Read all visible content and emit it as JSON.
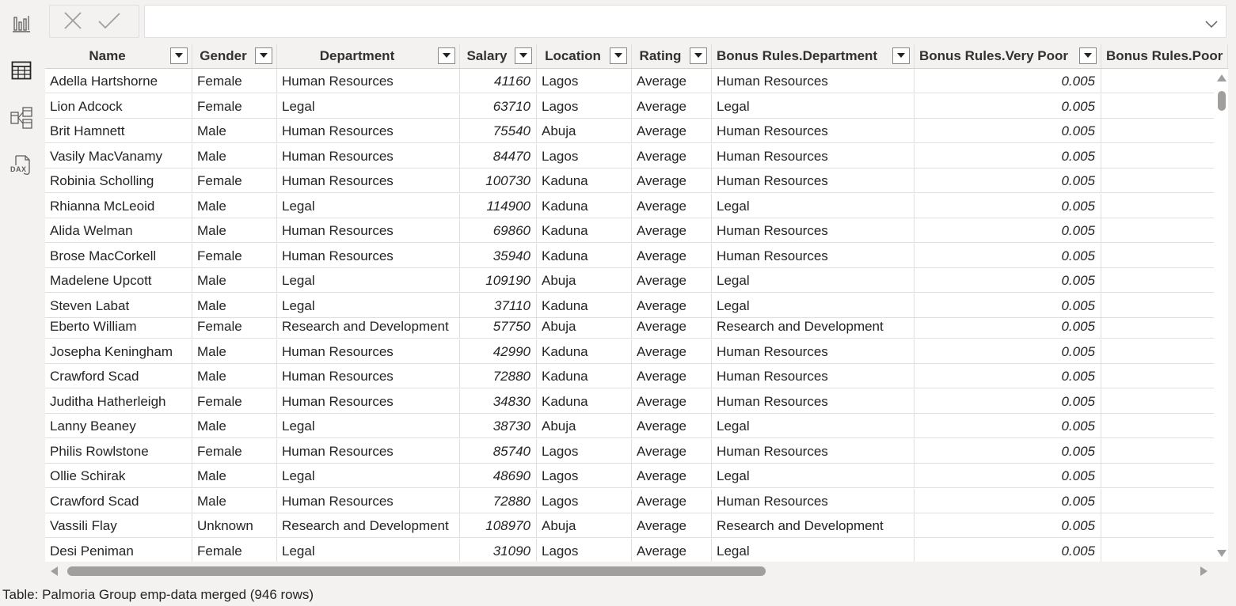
{
  "sidebar": {
    "items": [
      {
        "name": "report-view",
        "icon": "bar-chart-icon"
      },
      {
        "name": "table-view",
        "icon": "table-grid-icon"
      },
      {
        "name": "model-view",
        "icon": "model-diagram-icon"
      },
      {
        "name": "dax-query-view",
        "icon": "dax-icon",
        "label": "DAX"
      }
    ]
  },
  "formula_bar": {
    "cancel_icon": "close-icon",
    "commit_icon": "checkmark-icon",
    "value": "",
    "expand_icon": "chevron-down-icon"
  },
  "table": {
    "columns": [
      {
        "label": "Name",
        "align": "left"
      },
      {
        "label": "Gender",
        "align": "left"
      },
      {
        "label": "Department",
        "align": "left"
      },
      {
        "label": "Salary",
        "align": "right"
      },
      {
        "label": "Location",
        "align": "left"
      },
      {
        "label": "Rating",
        "align": "left"
      },
      {
        "label": "Bonus Rules.Department",
        "align": "left"
      },
      {
        "label": "Bonus Rules.Very Poor",
        "align": "right"
      },
      {
        "label": "Bonus Rules.Poor",
        "align": "right"
      }
    ],
    "rows": [
      [
        "Adella Hartshorne",
        "Female",
        "Human Resources",
        "41160",
        "Lagos",
        "Average",
        "Human Resources",
        "0.005",
        ""
      ],
      [
        "Lion Adcock",
        "Female",
        "Legal",
        "63710",
        "Lagos",
        "Average",
        "Legal",
        "0.005",
        ""
      ],
      [
        "Brit Hamnett",
        "Male",
        "Human Resources",
        "75540",
        "Abuja",
        "Average",
        "Human Resources",
        "0.005",
        ""
      ],
      [
        "Vasily MacVanamy",
        "Male",
        "Human Resources",
        "84470",
        "Lagos",
        "Average",
        "Human Resources",
        "0.005",
        ""
      ],
      [
        "Robinia Scholling",
        "Female",
        "Human Resources",
        "100730",
        "Kaduna",
        "Average",
        "Human Resources",
        "0.005",
        ""
      ],
      [
        "Rhianna McLeoid",
        "Male",
        "Legal",
        "114900",
        "Kaduna",
        "Average",
        "Legal",
        "0.005",
        ""
      ],
      [
        "Alida Welman",
        "Male",
        "Human Resources",
        "69860",
        "Kaduna",
        "Average",
        "Human Resources",
        "0.005",
        ""
      ],
      [
        "Brose MacCorkell",
        "Female",
        "Human Resources",
        "35940",
        "Kaduna",
        "Average",
        "Human Resources",
        "0.005",
        ""
      ],
      [
        "Madelene Upcott",
        "Male",
        "Legal",
        "109190",
        "Abuja",
        "Average",
        "Legal",
        "0.005",
        ""
      ],
      [
        "Steven Labat",
        "Male",
        "Legal",
        "37110",
        "Kaduna",
        "Average",
        "Legal",
        "0.005",
        ""
      ],
      [
        "Eberto William",
        "Female",
        "Research and Development",
        "57750",
        "Abuja",
        "Average",
        "Research and Development",
        "0.005",
        ""
      ],
      [
        "Josepha Keningham",
        "Male",
        "Human Resources",
        "42990",
        "Kaduna",
        "Average",
        "Human Resources",
        "0.005",
        ""
      ],
      [
        "Crawford Scad",
        "Male",
        "Human Resources",
        "72880",
        "Kaduna",
        "Average",
        "Human Resources",
        "0.005",
        ""
      ],
      [
        "Juditha Hatherleigh",
        "Female",
        "Human Resources",
        "34830",
        "Kaduna",
        "Average",
        "Human Resources",
        "0.005",
        ""
      ],
      [
        "Lanny Beaney",
        "Male",
        "Legal",
        "38730",
        "Abuja",
        "Average",
        "Legal",
        "0.005",
        ""
      ],
      [
        "Philis Rowlstone",
        "Female",
        "Human Resources",
        "85740",
        "Lagos",
        "Average",
        "Human Resources",
        "0.005",
        ""
      ],
      [
        "Ollie Schirak",
        "Male",
        "Legal",
        "48690",
        "Lagos",
        "Average",
        "Legal",
        "0.005",
        ""
      ],
      [
        "Crawford Scad",
        "Male",
        "Human Resources",
        "72880",
        "Lagos",
        "Average",
        "Human Resources",
        "0.005",
        ""
      ],
      [
        "Vassili Flay",
        "Unknown",
        "Research and Development",
        "108970",
        "Abuja",
        "Average",
        "Research and Development",
        "0.005",
        ""
      ],
      [
        "Desi Peniman",
        "Female",
        "Legal",
        "31090",
        "Lagos",
        "Average",
        "Legal",
        "0.005",
        ""
      ]
    ]
  },
  "status_bar": {
    "text": "Table: Palmoria Group emp-data merged (946 rows)"
  },
  "colors": {
    "background": "#f3f2f1",
    "grid_border": "#e1dfdd",
    "header_bg": "#f3f2f1",
    "icon": "#605e5c",
    "scrollbar": "#a19f9d"
  }
}
